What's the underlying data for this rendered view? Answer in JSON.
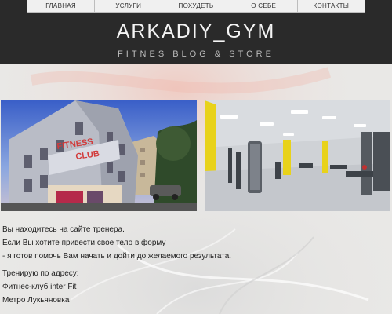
{
  "nav": {
    "items": [
      {
        "label": "ГЛАВНАЯ"
      },
      {
        "label": "УСЛУГИ"
      },
      {
        "label": "ПОХУДЕТЬ"
      },
      {
        "label": "О СЕБЕ"
      },
      {
        "label": "КОНТАКТЫ"
      }
    ]
  },
  "site": {
    "title": "ARKADIY_GYM",
    "tagline": "FITNES BLOG & STORE"
  },
  "photos": {
    "building_sign_line1": "FITNESS",
    "building_sign_line2": "CLUB"
  },
  "intro": {
    "line1": "Вы находитесь на сайте тренера.",
    "line2": "Если Вы хотите привести свое тело в форму",
    "line3": "- я готов помочь Вам начать и дойти до желаемого результата.",
    "line4": "Тренирую по адресу:",
    "line5": "Фитнес-клуб inter Fit",
    "line6": "Метро Лукьяновка"
  },
  "colors": {
    "header_bg": "#2a2a2a",
    "page_bg": "#e9e8e6",
    "accent_sign": "#d23a3a",
    "gym_yellow": "#e8d21a"
  }
}
